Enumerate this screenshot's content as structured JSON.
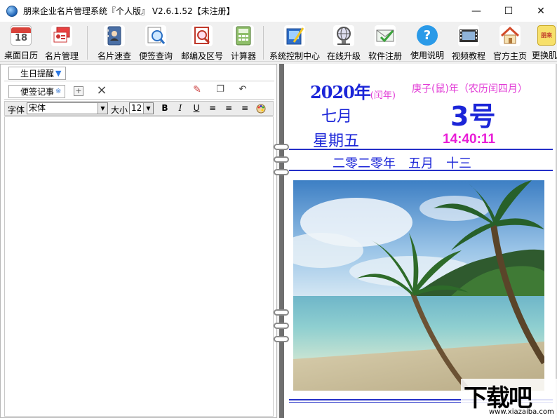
{
  "window": {
    "title": "朋来企业名片管理系统『个人版』 V2.6.1.52【未注册】",
    "minimize_glyph": "—",
    "maximize_glyph": "☐",
    "close_glyph": "✕"
  },
  "toolbar": {
    "items": [
      {
        "label": "桌面日历",
        "icon": "calendar-icon",
        "glyph": "18"
      },
      {
        "label": "名片管理",
        "icon": "business-card-icon",
        "glyph": ""
      },
      {
        "label": "名片速查",
        "icon": "address-book-icon",
        "glyph": ""
      },
      {
        "label": "便签查询",
        "icon": "search-note-icon",
        "glyph": ""
      },
      {
        "label": "邮编及区号",
        "icon": "zip-code-icon",
        "glyph": ""
      },
      {
        "label": "计算器",
        "icon": "calculator-icon",
        "glyph": ""
      },
      {
        "label": "系统控制中心",
        "icon": "control-center-icon",
        "glyph": ""
      },
      {
        "label": "在线升级",
        "icon": "online-upgrade-icon",
        "glyph": ""
      },
      {
        "label": "软件注册",
        "icon": "register-icon",
        "glyph": ""
      },
      {
        "label": "使用说明",
        "icon": "help-icon",
        "glyph": "?"
      },
      {
        "label": "视频教程",
        "icon": "video-icon",
        "glyph": ""
      },
      {
        "label": "官方主页",
        "icon": "home-icon",
        "glyph": ""
      },
      {
        "label": "更换肌",
        "icon": "skin-icon",
        "glyph": "朋来"
      }
    ]
  },
  "left": {
    "birthday_tab": "生日提醒",
    "memo_tab": "便签记事",
    "memo_tab_mark": "※",
    "format": {
      "font_label": "字体",
      "font_value": "宋体",
      "size_label": "大小",
      "size_value": "12",
      "bold": "B",
      "italic": "I",
      "underline": "U"
    }
  },
  "calendar": {
    "year": "2020年",
    "leap_note": "(闰年)",
    "ganzhi": "庚子(鼠)年（农历闰四月）",
    "month": "七月",
    "day": "3号",
    "weekday": "星期五",
    "time": "14:40:11",
    "lunar_date": "二零二零年　五月　十三"
  },
  "watermark": {
    "text": "下载吧",
    "url": "www.xiazaiba.com"
  },
  "colors": {
    "calendar_blue": "#1b25d8",
    "calendar_magenta": "#e91ed7"
  }
}
